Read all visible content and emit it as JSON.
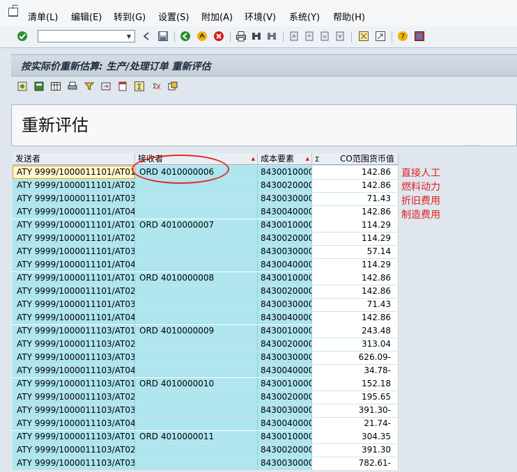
{
  "menu": {
    "items": [
      "清单(L)",
      "编辑(E)",
      "转到(G)",
      "设置(S)",
      "附加(A)",
      "环境(V)",
      "系统(Y)",
      "帮助(H)"
    ]
  },
  "toolbar": {
    "command_value": ""
  },
  "title": "按实际价重新估算: 生产/处理订单 重新评估",
  "header_text": "重新评估",
  "table": {
    "columns": [
      "发送者",
      "接收者",
      "成本要素",
      "CO范围货币值"
    ],
    "sum_symbol": "Σ",
    "rows": [
      {
        "sender": "ATY 9999/1000011101/AT01",
        "receiver": "ORD 4010000006",
        "cost": "8430010000",
        "value": "142.86"
      },
      {
        "sender": "ATY 9999/1000011101/AT02",
        "receiver": "",
        "cost": "8430020000",
        "value": "142.86"
      },
      {
        "sender": "ATY 9999/1000011101/AT03",
        "receiver": "",
        "cost": "8430030000",
        "value": "71.43"
      },
      {
        "sender": "ATY 9999/1000011101/AT04",
        "receiver": "",
        "cost": "8430040000",
        "value": "142.86"
      },
      {
        "sender": "ATY 9999/1000011101/AT01",
        "receiver": "ORD 4010000007",
        "cost": "8430010000",
        "value": "114.29"
      },
      {
        "sender": "ATY 9999/1000011101/AT02",
        "receiver": "",
        "cost": "8430020000",
        "value": "114.29"
      },
      {
        "sender": "ATY 9999/1000011101/AT03",
        "receiver": "",
        "cost": "8430030000",
        "value": "57.14"
      },
      {
        "sender": "ATY 9999/1000011101/AT04",
        "receiver": "",
        "cost": "8430040000",
        "value": "114.29"
      },
      {
        "sender": "ATY 9999/1000011101/AT01",
        "receiver": "ORD 4010000008",
        "cost": "8430010000",
        "value": "142.86"
      },
      {
        "sender": "ATY 9999/1000011101/AT02",
        "receiver": "",
        "cost": "8430020000",
        "value": "142.86"
      },
      {
        "sender": "ATY 9999/1000011101/AT03",
        "receiver": "",
        "cost": "8430030000",
        "value": "71.43"
      },
      {
        "sender": "ATY 9999/1000011101/AT04",
        "receiver": "",
        "cost": "8430040000",
        "value": "142.86"
      },
      {
        "sender": "ATY 9999/1000011103/AT01",
        "receiver": "ORD 4010000009",
        "cost": "8430010000",
        "value": "243.48"
      },
      {
        "sender": "ATY 9999/1000011103/AT02",
        "receiver": "",
        "cost": "8430020000",
        "value": "313.04"
      },
      {
        "sender": "ATY 9999/1000011103/AT03",
        "receiver": "",
        "cost": "8430030000",
        "value": "626.09-"
      },
      {
        "sender": "ATY 9999/1000011103/AT04",
        "receiver": "",
        "cost": "8430040000",
        "value": "34.78-"
      },
      {
        "sender": "ATY 9999/1000011103/AT01",
        "receiver": "ORD 4010000010",
        "cost": "8430010000",
        "value": "152.18"
      },
      {
        "sender": "ATY 9999/1000011103/AT02",
        "receiver": "",
        "cost": "8430020000",
        "value": "195.65"
      },
      {
        "sender": "ATY 9999/1000011103/AT03",
        "receiver": "",
        "cost": "8430030000",
        "value": "391.30-"
      },
      {
        "sender": "ATY 9999/1000011103/AT04",
        "receiver": "",
        "cost": "8430040000",
        "value": "21.74-"
      },
      {
        "sender": "ATY 9999/1000011103/AT01",
        "receiver": "ORD 4010000011",
        "cost": "8430010000",
        "value": "304.35"
      },
      {
        "sender": "ATY 9999/1000011103/AT02",
        "receiver": "",
        "cost": "8430020000",
        "value": "391.30"
      },
      {
        "sender": "ATY 9999/1000011103/AT03",
        "receiver": "",
        "cost": "8430030000",
        "value": "782.61-"
      }
    ]
  },
  "annotations": [
    "直接人工",
    "燃料动力",
    "折旧费用",
    "制造费用"
  ],
  "colors": {
    "grid_cyan": "#aee5ef",
    "annotation_red": "#e02020"
  }
}
